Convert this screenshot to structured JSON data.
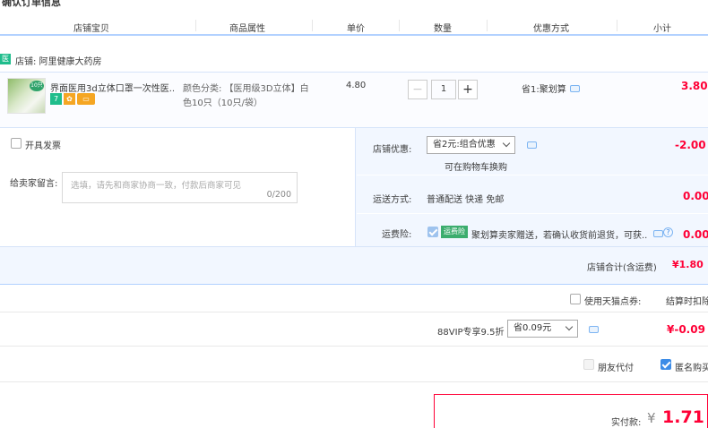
{
  "header": {
    "cut_title": "确认订单信息",
    "columns": [
      "店铺宝贝",
      "商品属性",
      "单价",
      "数量",
      "优惠方式",
      "小计"
    ]
  },
  "shop": {
    "icon_label": "医",
    "name": "店铺: 阿里健康大药房"
  },
  "item": {
    "thumb_tag": "10只",
    "title": "界面医用3d立体口罩一次性医...",
    "badges": [
      {
        "label": "7",
        "color": "#1fbd8c"
      },
      {
        "label": "✿",
        "color": "#f5a623"
      },
      {
        "label": "▭",
        "color": "#f5a623"
      }
    ],
    "attr_line1": "颜色分类: 【医用级3D立体】白",
    "attr_line2": "色10只（10只/袋）",
    "price": "4.80",
    "quantity": "1",
    "minus": "−",
    "plus": "+",
    "promo": "省1:聚划算",
    "subtotal": "3.80"
  },
  "invoice": {
    "label": "开具发票"
  },
  "message": {
    "label": "给卖家留言:",
    "placeholder": "选填，请先和商家协商一致，付款后商家可见",
    "counter": "0/200"
  },
  "shop_discount": {
    "label": "店铺优惠:",
    "selected": "省2元:组合优惠",
    "hint": "可在购物车换购",
    "amount": "-2.00"
  },
  "shipping": {
    "label": "运送方式:",
    "value": "普通配送 快递 免邮",
    "amount": "0.00"
  },
  "insurance": {
    "label": "运费险:",
    "tag": "运费险",
    "text": "聚划算卖家赠送，若确认收货前退货，可获...",
    "help": "?",
    "amount": "0.00"
  },
  "shop_total": {
    "label": "店铺合计(含运费)",
    "amount": "¥1.80"
  },
  "points": {
    "label": "使用天猫点券:",
    "cut_text": "结算时扣除"
  },
  "vip": {
    "label": "88VIP专享9.5折",
    "selected": "省0.09元",
    "amount": "¥-0.09"
  },
  "options": {
    "friend_pay": "朋友代付",
    "anonymous": "匿名购买"
  },
  "payment": {
    "label": "实付款:",
    "currency": "¥",
    "amount": "1.71"
  },
  "colors": {
    "accent_blue": "#b2d1ff",
    "price_red": "#ff0036",
    "panel_blue": "#f2f7ff"
  }
}
